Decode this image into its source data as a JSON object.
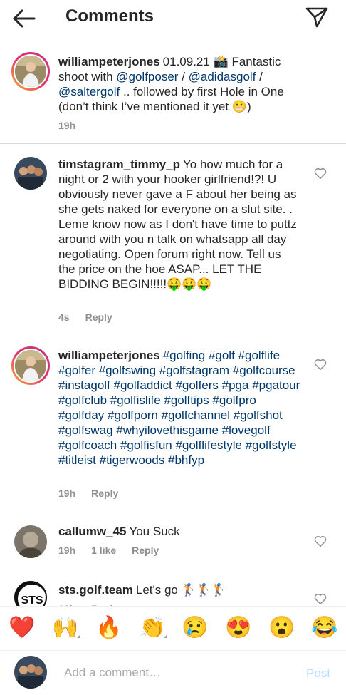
{
  "header": {
    "title": "Comments"
  },
  "comments": [
    {
      "username": "williampeterjones",
      "pre": "01.09.21 📸 Fantastic shoot with ",
      "link1": "@golfposer",
      "mid1": " / ",
      "link2": "@adidasgolf",
      "mid2": " / ",
      "link3": "@saltergolf",
      "post": " .. followed by first Hole in One (don’t think I’ve mentioned it yet 😬)",
      "time": "19h"
    },
    {
      "username": "timstagram_timmy_p",
      "text": "Yo how much for a night or 2 with your hooker girlfriend!?! U obviously never gave a F about her being as she gets naked for everyone on a slut site. . Leme know now as I don't have time to puttz around with you n talk on whatsapp all day negotiating. Open forum right now. Tell us the price on the hoe ASAP... LET THE BIDDING BEGIN!!!!!🤑🤑🤑",
      "time": "4s",
      "reply": "Reply"
    },
    {
      "username": "williampeterjones",
      "hashtags": "#golfing #golf #golflife #golfer #golfswing #golfstagram #golfcourse #instagolf #golfaddict #golfers #pga #pgatour #golfclub #golfislife #golftips #golfpro #golfday #golfporn #golfchannel #golfshot #golfswag #whyilovethisgame #lovegolf #golfcoach #golfisfun #golflifestyle #golfstyle #titleist #tigerwoods #bhfyp",
      "time": "19h",
      "reply": "Reply"
    },
    {
      "username": "callumw_45",
      "text": "You Suck",
      "time": "19h",
      "likes": "1 like",
      "reply": "Reply"
    },
    {
      "username": "sts.golf.team",
      "text": "Let's go 🏌️🏌️🏌️",
      "avatar_text": "STS",
      "time": "12h",
      "reply": "Reply"
    }
  ],
  "emojis": [
    "❤️",
    "🙌",
    "🔥",
    "👏",
    "😢",
    "😍",
    "😮",
    "😂"
  ],
  "input": {
    "placeholder": "Add a comment…",
    "post_label": "Post"
  },
  "colors": {
    "link": "#00376b",
    "muted": "#8e8e8e",
    "post_disabled": "#b3dbff"
  }
}
